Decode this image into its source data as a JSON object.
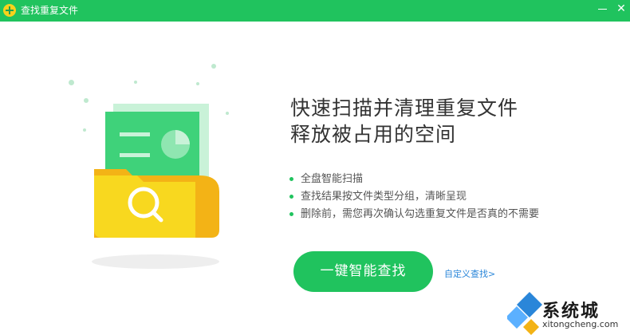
{
  "window": {
    "title": "查找重复文件",
    "minimize_icon": "minimize-icon",
    "close_glyph": "✕"
  },
  "headline": {
    "line1": "快速扫描并清理重复文件",
    "line2": "释放被占用的空间"
  },
  "features": [
    "全盘智能扫描",
    "查找结果按文件类型分组，清晰呈现",
    "删除前，需您再次确认勾选重复文件是否真的不需要"
  ],
  "actions": {
    "scan_label": "一键智能查找",
    "custom_label": "自定义查找>"
  },
  "watermark": {
    "name": "系统城",
    "url": "xitongcheng.com"
  },
  "colors": {
    "accent": "#20c35e",
    "link": "#2a86d9",
    "folder": "#f8d21c"
  }
}
